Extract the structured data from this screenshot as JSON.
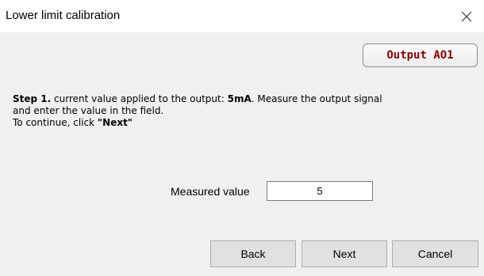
{
  "window": {
    "title": "Lower limit calibration",
    "close_glyph": "close-icon"
  },
  "badge": {
    "label": "Output AO1"
  },
  "instructions": {
    "step_label": "Step 1.",
    "line1_text": " current value applied to the output: ",
    "current_value": "5mA",
    "line1_tail": ". Measure the output signal",
    "line2": "and enter the value in the field.",
    "line3_prefix": "To continue, click ",
    "line3_action": "\"Next\""
  },
  "form": {
    "measured_label": "Measured value",
    "measured_value": "5"
  },
  "buttons": {
    "back": "Back",
    "next": "Next",
    "cancel": "Cancel"
  },
  "colors": {
    "badge_text": "#8b0000",
    "window_bg": "#f0f0f0",
    "titlebar_bg": "#ffffff"
  }
}
